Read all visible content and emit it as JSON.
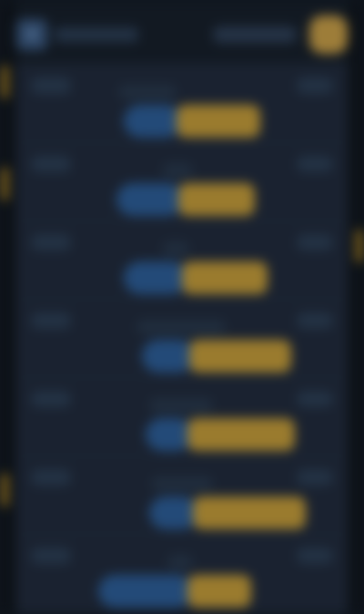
{
  "header": {
    "brand_label": "",
    "search_label": "",
    "avatar_label": ""
  },
  "rows": [
    {
      "left": "",
      "title": "",
      "right": "",
      "blue": "",
      "gold": ""
    },
    {
      "left": "",
      "title": "",
      "right": "",
      "blue": "",
      "gold": ""
    },
    {
      "left": "",
      "title": "",
      "right": "",
      "blue": "",
      "gold": ""
    },
    {
      "left": "",
      "title": "",
      "right": "",
      "blue": "",
      "gold": ""
    },
    {
      "left": "",
      "title": "",
      "right": "",
      "blue": "",
      "gold": ""
    },
    {
      "left": "",
      "title": "",
      "right": "",
      "blue": "",
      "gold": ""
    },
    {
      "left": "",
      "title": "",
      "right": "",
      "blue": "",
      "gold": ""
    }
  ],
  "colors": {
    "background": "#121922",
    "panel": "#1a2230",
    "blue": "#234a78",
    "gold": "#9a7b2e",
    "accent": "#8b6d21"
  }
}
